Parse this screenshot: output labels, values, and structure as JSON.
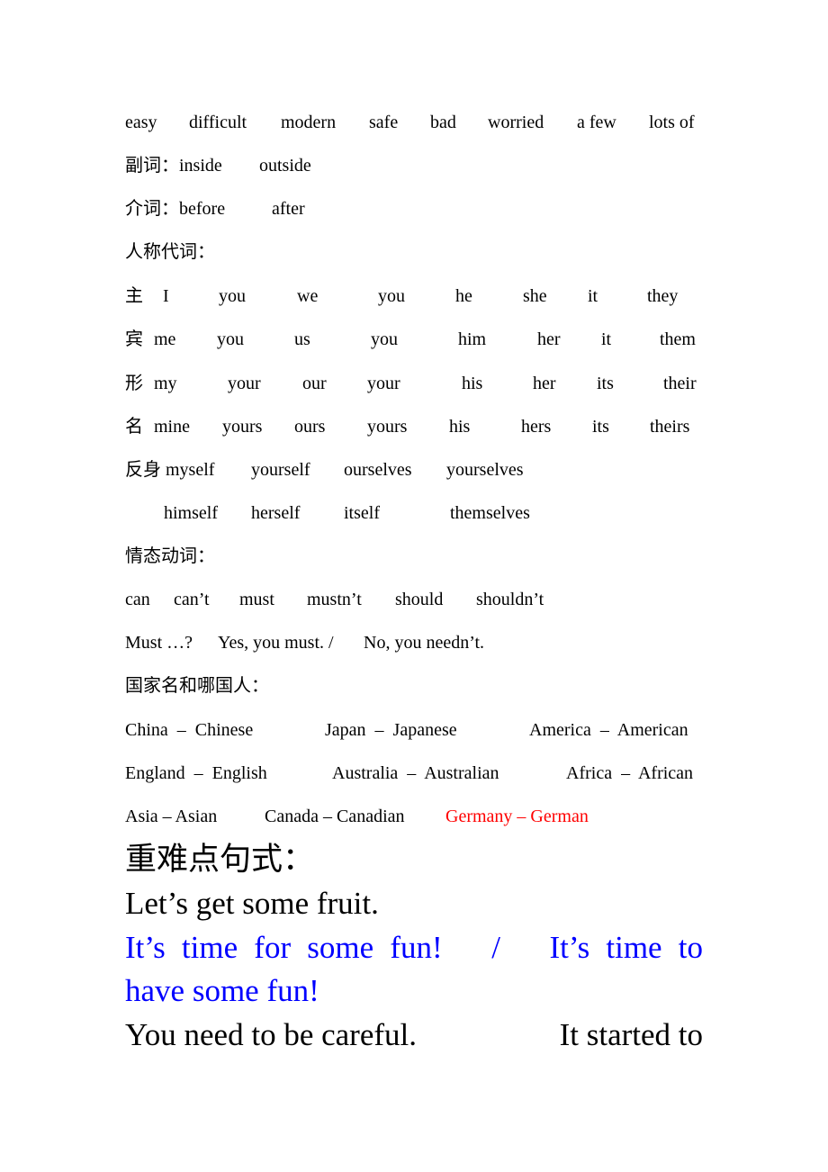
{
  "colors": {
    "text": "#000000",
    "highlight_red": "#ff0000",
    "highlight_blue": "#0000ff"
  },
  "rows": [
    [
      "easy",
      "difficult",
      "modern",
      "safe",
      "bad",
      "worried",
      "a few",
      "lots of"
    ],
    [
      "副词：inside",
      "outside"
    ],
    [
      "介词：before",
      "after"
    ],
    [
      "人称代词："
    ],
    [
      "主",
      "I",
      "you",
      "we",
      "you",
      "he",
      "she",
      "it",
      "they"
    ],
    [
      "宾",
      "me",
      "you",
      "us",
      "you",
      "him",
      "her",
      "it",
      "them"
    ],
    [
      "形",
      "my",
      "your",
      "our",
      "your",
      "his",
      "her",
      "its",
      "their"
    ],
    [
      "名",
      "mine",
      "yours",
      "ours",
      "yours",
      "his",
      "hers",
      "its",
      "theirs"
    ],
    [
      "反身 myself",
      "yourself",
      "ourselves",
      "yourselves"
    ],
    [
      "himself",
      "herself",
      "itself",
      "themselves"
    ],
    [
      "情态动词："
    ],
    [
      "can",
      "can’t",
      "must",
      "mustn’t",
      "should",
      "shouldn’t"
    ],
    [
      "Must …?",
      "Yes, you must. /",
      "No, you needn’t."
    ],
    [
      "国家名和哪国人："
    ],
    [
      "China  –  Chinese",
      "Japan  –  Japanese",
      "America  –  American"
    ],
    [
      "England  –  English",
      "Australia  –  Australian",
      "Africa  –  African"
    ],
    [
      "Asia – Asian",
      "Canada – Canadian",
      "Germany – German"
    ]
  ],
  "key_sentences": {
    "heading": "重难点句式：",
    "line1": "Let’s get some fruit.",
    "line2": "It’s time for some fun!   /   It’s time to",
    "line3": "have some fun!",
    "line4a": "You need to be careful.",
    "line4b": "It started to"
  }
}
